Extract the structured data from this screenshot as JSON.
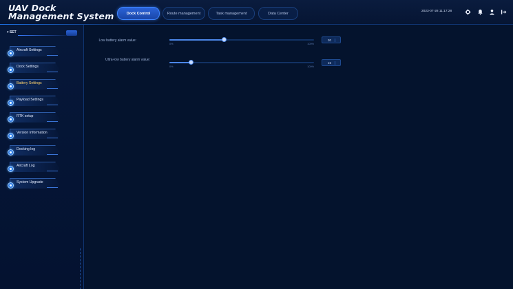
{
  "app": {
    "title": "UAV Dock Management System"
  },
  "nav": {
    "tabs": [
      {
        "label": "Dock Control",
        "active": true
      },
      {
        "label": "Route management",
        "active": false
      },
      {
        "label": "Task management",
        "active": false
      },
      {
        "label": "Data Center",
        "active": false
      }
    ]
  },
  "header": {
    "datetime": "2023-07-28 11:17:28",
    "icons": [
      "gear-icon",
      "bell-icon",
      "user-icon",
      "logout-icon"
    ]
  },
  "sidebar": {
    "top_label": "▾ SET",
    "items": [
      {
        "label": "Aircraft Settings",
        "active": false
      },
      {
        "label": "Dock Settings",
        "active": false
      },
      {
        "label": "Battery Settings",
        "active": true
      },
      {
        "label": "Payload Settings",
        "active": false
      },
      {
        "label": "RTK setup",
        "active": false
      },
      {
        "label": "Version Information",
        "active": false
      },
      {
        "label": "Docking log",
        "active": false
      },
      {
        "label": "Aircraft Log",
        "active": false
      },
      {
        "label": "System Upgrade",
        "active": false
      }
    ]
  },
  "settings": {
    "low_battery": {
      "label": "Low battery alarm value:",
      "min": "0%",
      "max": "100%",
      "value_label": "30",
      "value_fraction": 0.38
    },
    "ultra_low_battery": {
      "label": "Ultra-low battery alarm value:",
      "min": "0%",
      "max": "100%",
      "value_label": "15",
      "value_fraction": 0.15
    }
  },
  "colors": {
    "background": "#04142f",
    "accent": "#3a7cff",
    "active_sidebar_text": "#ffd36b"
  }
}
